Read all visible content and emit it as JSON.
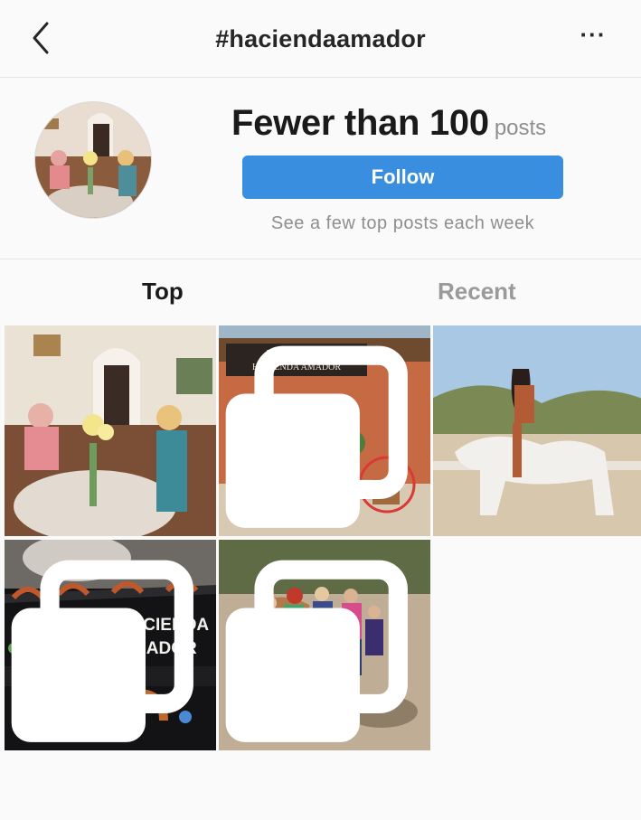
{
  "header": {
    "back_icon": "chevron-left-icon",
    "title": "#haciendaamador",
    "more_label": "···"
  },
  "profile": {
    "count": "Fewer than 100",
    "count_suffix": "posts",
    "follow_label": "Follow",
    "subtext": "See a few top posts each week"
  },
  "tabs": [
    {
      "label": "Top",
      "active": true
    },
    {
      "label": "Recent",
      "active": false
    }
  ],
  "posts": [
    {
      "id": 1,
      "multi": false
    },
    {
      "id": 2,
      "multi": true,
      "sign_line1": "WELCOME TO",
      "sign_line2": "HACIENDA AMADOR"
    },
    {
      "id": 3,
      "multi": false
    },
    {
      "id": 4,
      "multi": true,
      "text_line1": "HACIENDA",
      "text_line2": "AMADOR"
    },
    {
      "id": 5,
      "multi": true
    }
  ],
  "colors": {
    "follow_bg": "#3a8ee0",
    "muted": "#8e8e8e",
    "text": "#262626"
  }
}
